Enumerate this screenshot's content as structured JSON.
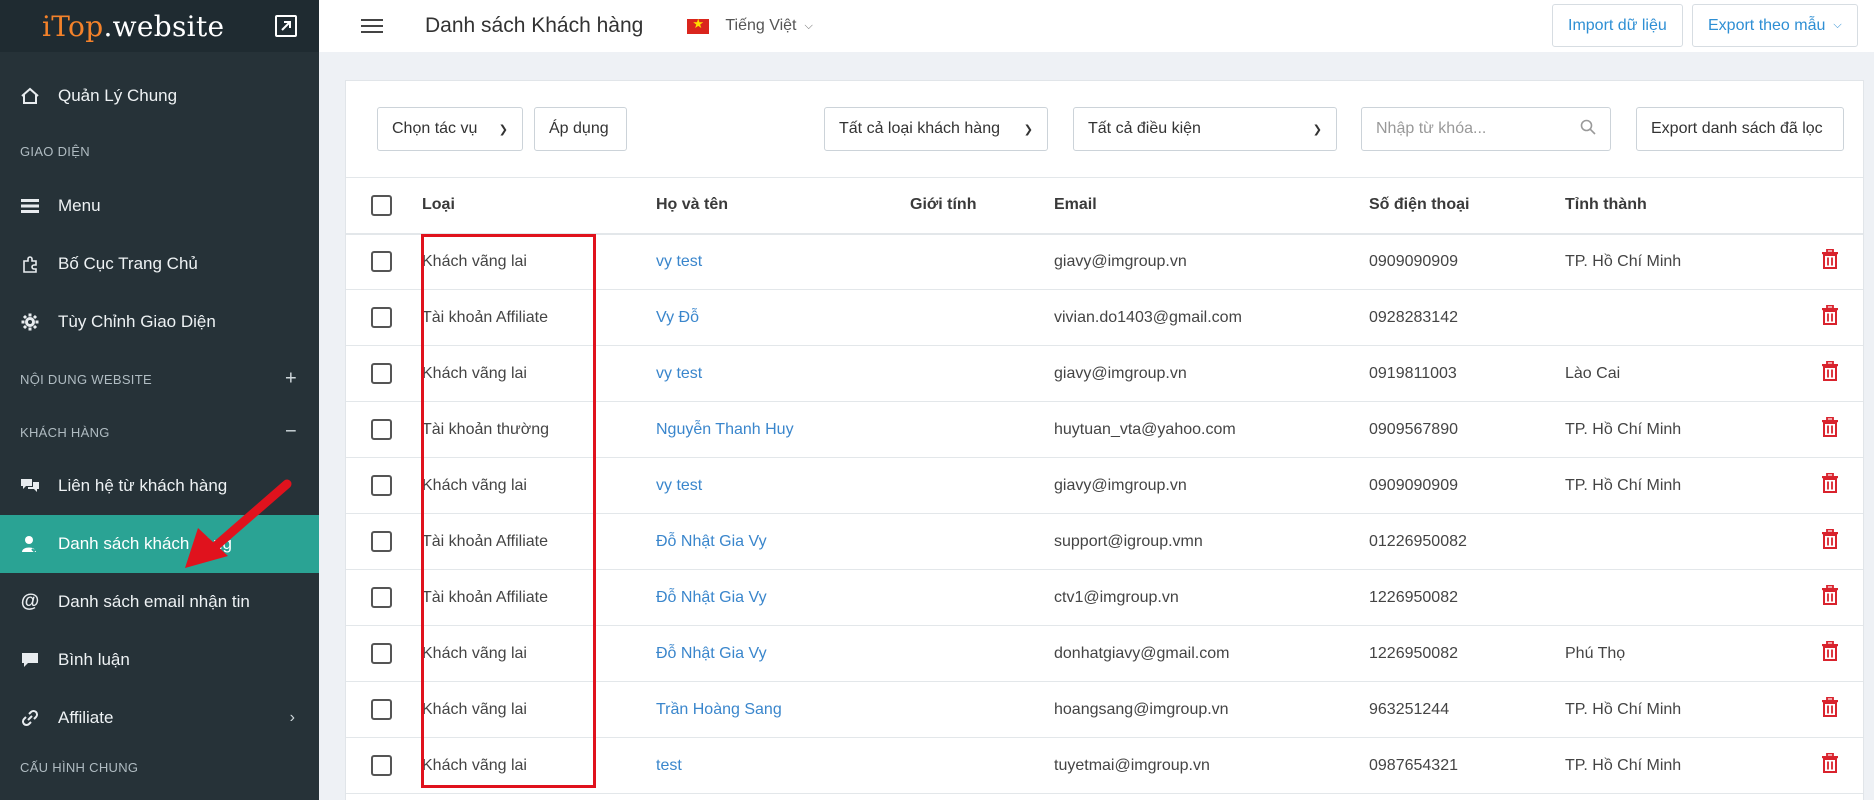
{
  "app": {
    "logo_brand": "iTop",
    "logo_rest": ".website"
  },
  "sidebar": {
    "items_top": [
      {
        "label": "Quản Lý Chung",
        "icon": "home-icon"
      }
    ],
    "section_giao_dien": "GIAO DIỆN",
    "giao_dien_items": [
      {
        "label": "Menu",
        "icon": "menu-icon"
      },
      {
        "label": "Bố Cục Trang Chủ",
        "icon": "puzzle-icon"
      },
      {
        "label": "Tùy Chỉnh Giao Diện",
        "icon": "gear-icon"
      }
    ],
    "section_noi_dung": "NỘI DUNG WEBSITE",
    "section_noi_dung_toggle": "+",
    "section_khach_hang": "KHÁCH HÀNG",
    "section_khach_hang_toggle": "−",
    "khach_hang_items": [
      {
        "label": "Liên hệ từ khách hàng",
        "icon": "chat-icon"
      },
      {
        "label": "Danh sách khách hàng",
        "icon": "user-icon",
        "active": true
      },
      {
        "label": "Danh sách email nhận tin",
        "icon": "at-icon"
      },
      {
        "label": "Bình luận",
        "icon": "comment-icon"
      },
      {
        "label": "Affiliate",
        "icon": "link-icon",
        "chevron": "›"
      }
    ],
    "section_cau_hinh": "CẤU HÌNH CHUNG"
  },
  "header": {
    "title": "Danh sách Khách hàng",
    "language": "Tiếng Việt",
    "import_label": "Import dữ liệu",
    "export_label": "Export theo mẫu"
  },
  "toolbar": {
    "action_select": "Chọn tác vụ",
    "apply_label": "Áp dụng",
    "type_filter": "Tất cả loại khách hàng",
    "condition_filter": "Tất cả điều kiện",
    "search_placeholder": "Nhập từ khóa...",
    "export_filtered_label": "Export danh sách đã lọc"
  },
  "table": {
    "columns": [
      "Loại",
      "Họ và tên",
      "Giới tính",
      "Email",
      "Số điện thoại",
      "Tỉnh thành"
    ],
    "rows": [
      {
        "type": "Khách vãng lai",
        "name": "vy test",
        "gender": "",
        "email": "giavy@imgroup.vn",
        "phone": "0909090909",
        "province": "TP. Hồ Chí Minh"
      },
      {
        "type": "Tài khoản Affiliate",
        "name": "Vy Đỗ",
        "gender": "",
        "email": "vivian.do1403@gmail.com",
        "phone": "0928283142",
        "province": ""
      },
      {
        "type": "Khách vãng lai",
        "name": "vy test",
        "gender": "",
        "email": "giavy@imgroup.vn",
        "phone": "0919811003",
        "province": "Lào Cai"
      },
      {
        "type": "Tài khoản thường",
        "name": "Nguyễn Thanh Huy",
        "gender": "",
        "email": "huytuan_vta@yahoo.com",
        "phone": "0909567890",
        "province": "TP. Hồ Chí Minh"
      },
      {
        "type": "Khách vãng lai",
        "name": "vy test",
        "gender": "",
        "email": "giavy@imgroup.vn",
        "phone": "0909090909",
        "province": "TP. Hồ Chí Minh"
      },
      {
        "type": "Tài khoản Affiliate",
        "name": "Đỗ Nhật Gia Vy",
        "gender": "",
        "email": "support@igroup.vmn",
        "phone": "01226950082",
        "province": ""
      },
      {
        "type": "Tài khoản Affiliate",
        "name": "Đỗ Nhật Gia Vy",
        "gender": "",
        "email": "ctv1@imgroup.vn",
        "phone": "1226950082",
        "province": ""
      },
      {
        "type": "Khách vãng lai",
        "name": "Đỗ Nhật Gia Vy",
        "gender": "",
        "email": "donhatgiavy@gmail.com",
        "phone": "1226950082",
        "province": "Phú Thọ"
      },
      {
        "type": "Khách vãng lai",
        "name": "Trần Hoàng Sang",
        "gender": "",
        "email": "hoangsang@imgroup.vn",
        "phone": "963251244",
        "province": "TP. Hồ Chí Minh"
      },
      {
        "type": "Khách vãng lai",
        "name": "test",
        "gender": "",
        "email": "tuyetmai@imgroup.vn",
        "phone": "0987654321",
        "province": "TP. Hồ Chí Minh"
      }
    ]
  },
  "colors": {
    "sidebar_bg": "#263238",
    "active_item": "#2aa394",
    "link": "#3a86cc",
    "delete": "#d9232d",
    "annotation": "#e0121d"
  }
}
